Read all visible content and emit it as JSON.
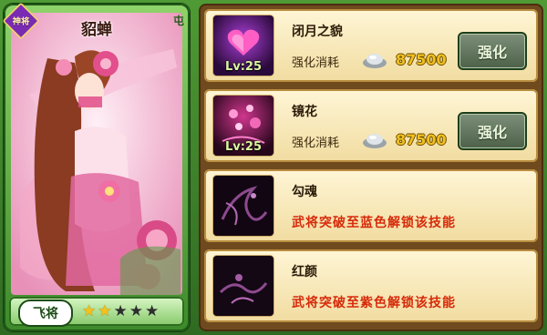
{
  "hero": {
    "badge": "神将",
    "corner": "屯",
    "name": "貂蝉",
    "type_label": "飞将",
    "stars": [
      true,
      true,
      false,
      false,
      false
    ]
  },
  "skills": [
    {
      "icon": "heart-skill-icon",
      "name": "闭月之貌",
      "level": "Lv:25",
      "cost_label": "强化消耗",
      "cost": "87500",
      "button": "强化",
      "locked_text": null
    },
    {
      "icon": "flower-skill-icon",
      "name": "镜花",
      "level": "Lv:25",
      "cost_label": "强化消耗",
      "cost": "87500",
      "button": "强化",
      "locked_text": null
    },
    {
      "icon": "soul-skill-icon",
      "name": "勾魂",
      "level": null,
      "locked_text": "武将突破至蓝色解锁该技能"
    },
    {
      "icon": "beauty-skill-icon",
      "name": "红颜",
      "level": null,
      "locked_text": "武将突破至紫色解锁该技能"
    }
  ],
  "colors": {
    "card_green": "#3d8a2a",
    "panel_brown": "#6e4a1e",
    "gold": "#f0c020",
    "lock_red": "#d62a0a"
  }
}
